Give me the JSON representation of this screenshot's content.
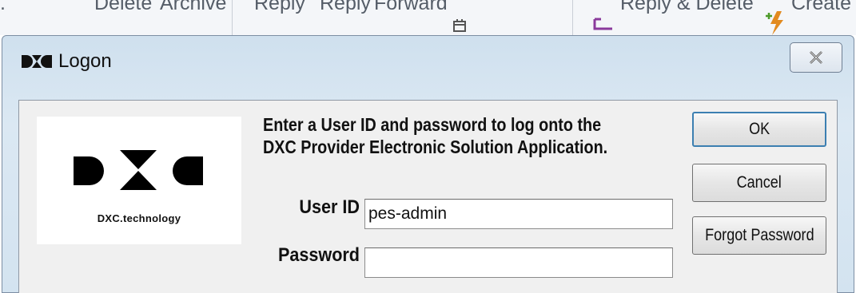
{
  "ribbon": {
    "delete_label": "Delete",
    "archive_label": "Archive",
    "reply_label": "Reply",
    "reply_all_label": "Reply",
    "forward_label": "Forward",
    "reply_delete_label": "Reply & Delete",
    "create_label": "Create"
  },
  "window": {
    "title": "Logon",
    "message_line1": "Enter a User ID and password to log onto the",
    "message_line2": "DXC Provider Electronic Solution Application.",
    "logo_caption": "DXC.technology"
  },
  "form": {
    "user_id_label": "User ID",
    "user_id_value": "pes-admin",
    "password_label": "Password",
    "password_value": ""
  },
  "buttons": {
    "ok": "OK",
    "cancel": "Cancel",
    "forgot_password": "Forgot Password"
  },
  "colors": {
    "title_bar": "#d3e3f0",
    "dialog_body": "#f0f0f0",
    "default_button_border": "#3c7fb1",
    "reply_icon": "#8a3a9c",
    "create_icon_green": "#4c9a2a",
    "create_icon_orange": "#e28a1f"
  }
}
